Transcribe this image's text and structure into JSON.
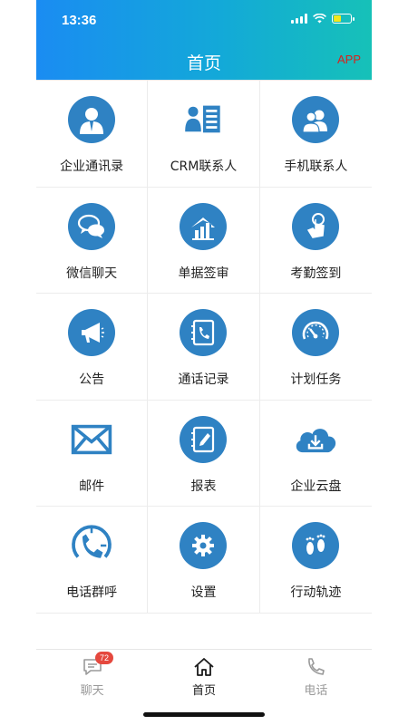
{
  "status": {
    "time": "13:36"
  },
  "header": {
    "title": "首页",
    "app_link": "APP"
  },
  "grid": [
    {
      "label": "企业通讯录",
      "icon": "enterprise-contacts-icon"
    },
    {
      "label": "CRM联系人",
      "icon": "crm-contacts-icon"
    },
    {
      "label": "手机联系人",
      "icon": "phone-contacts-icon"
    },
    {
      "label": "微信聊天",
      "icon": "wechat-chat-icon"
    },
    {
      "label": "单据签审",
      "icon": "document-approval-icon"
    },
    {
      "label": "考勤签到",
      "icon": "attendance-checkin-icon"
    },
    {
      "label": "公告",
      "icon": "announcement-icon"
    },
    {
      "label": "通话记录",
      "icon": "call-log-icon"
    },
    {
      "label": "计划任务",
      "icon": "plan-task-icon"
    },
    {
      "label": "邮件",
      "icon": "mail-icon"
    },
    {
      "label": "报表",
      "icon": "report-icon"
    },
    {
      "label": "企业云盘",
      "icon": "cloud-drive-icon"
    },
    {
      "label": "电话群呼",
      "icon": "group-call-icon"
    },
    {
      "label": "设置",
      "icon": "settings-icon"
    },
    {
      "label": "行动轨迹",
      "icon": "footprint-icon"
    }
  ],
  "tabbar": {
    "items": [
      {
        "label": "聊天",
        "icon": "chat-icon",
        "badge": "72"
      },
      {
        "label": "首页",
        "icon": "home-icon",
        "active": true
      },
      {
        "label": "电话",
        "icon": "phone-icon"
      }
    ]
  },
  "colors": {
    "header_start": "#1a8cf2",
    "header_end": "#16c1b8",
    "icon_blue": "#2f82c3",
    "badge": "#e5483e",
    "app_link": "#d9221c"
  }
}
